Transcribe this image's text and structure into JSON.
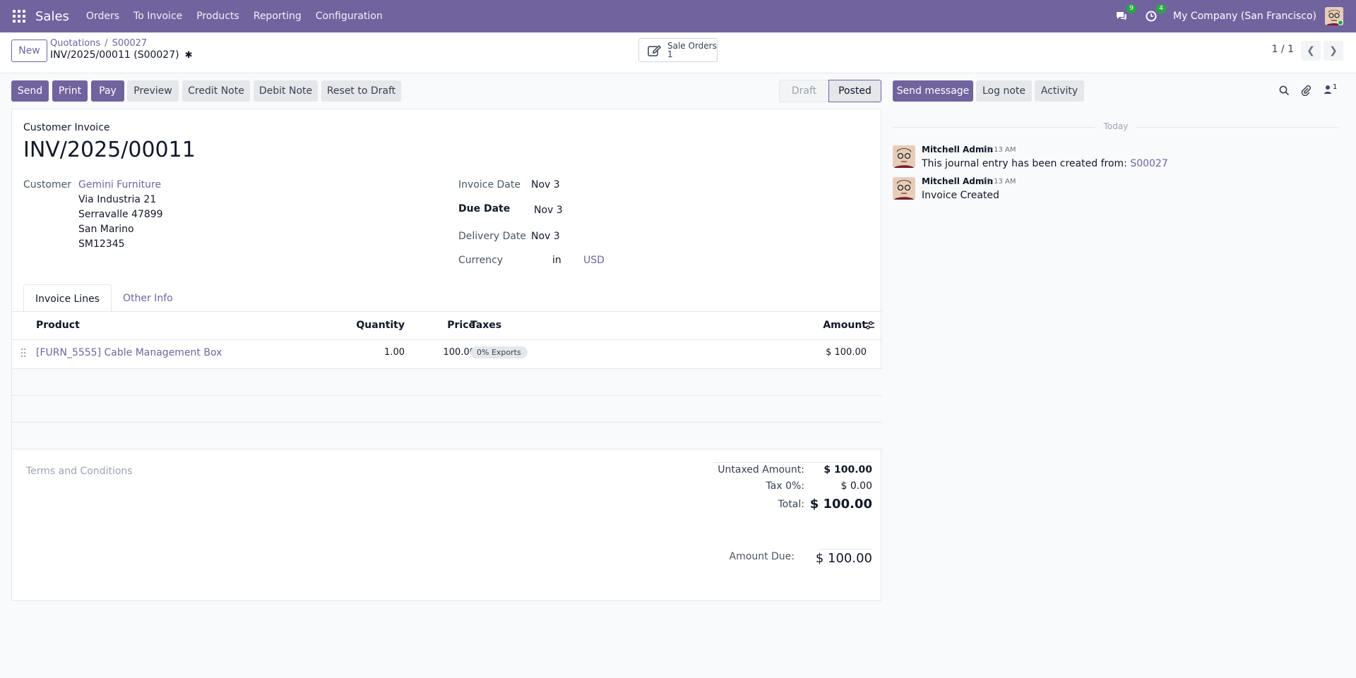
{
  "navbar": {
    "app_name": "Sales",
    "menu": [
      "Orders",
      "To Invoice",
      "Products",
      "Reporting",
      "Configuration"
    ],
    "messages_count": "9",
    "activities_count": "4",
    "company": "My Company (San Francisco)"
  },
  "control": {
    "new_label": "New",
    "breadcrumb": [
      "Quotations",
      "S00027"
    ],
    "record_title": "INV/2025/00011 (S00027)",
    "smart_button": {
      "label": "Sale Orders",
      "count": "1"
    },
    "pager": "1 / 1"
  },
  "actions": [
    "Send",
    "Print",
    "Pay",
    "Preview",
    "Credit Note",
    "Debit Note",
    "Reset to Draft"
  ],
  "status": {
    "draft": "Draft",
    "posted": "Posted"
  },
  "invoice": {
    "type": "Customer Invoice",
    "name": "INV/2025/00011",
    "customer_label": "Customer",
    "customer_name": "Gemini Furniture",
    "address": [
      "Via Industria 21",
      "Serravalle 47899",
      "San Marino",
      "SM12345"
    ],
    "invoice_date_label": "Invoice Date",
    "invoice_date": "Nov 3",
    "due_date_label": "Due Date",
    "due_date": "Nov 3",
    "delivery_date_label": "Delivery Date",
    "delivery_date": "Nov 3",
    "currency_label": "Currency",
    "currency_in": "in",
    "currency": "USD"
  },
  "tabs": [
    "Invoice Lines",
    "Other Info"
  ],
  "lines": {
    "headers": {
      "product": "Product",
      "quantity": "Quantity",
      "price": "Price",
      "taxes": "Taxes",
      "amount": "Amount"
    },
    "rows": [
      {
        "product": "[FURN_5555] Cable Management Box",
        "quantity": "1.00",
        "price": "100.00",
        "tax": "0% Exports",
        "amount": "$ 100.00"
      }
    ]
  },
  "terms_placeholder": "Terms and Conditions",
  "totals": {
    "untaxed_label": "Untaxed Amount:",
    "untaxed": "$ 100.00",
    "tax_label": "Tax 0%:",
    "tax": "$ 0.00",
    "total_label": "Total:",
    "total": "$ 100.00",
    "due_label": "Amount Due:",
    "due": "$ 100.00"
  },
  "chatter": {
    "send_message": "Send message",
    "log_note": "Log note",
    "activity": "Activity",
    "followers_count": "1",
    "date_separator": "Today",
    "messages": [
      {
        "author": "Mitchell Admin",
        "time": "11:13 AM",
        "body": "This journal entry has been created from: ",
        "link": "S00027"
      },
      {
        "author": "Mitchell Admin",
        "time": "11:13 AM",
        "body": "Invoice Created"
      }
    ]
  },
  "colors": {
    "brand": "#71639e",
    "badge_green": "#28a745"
  }
}
